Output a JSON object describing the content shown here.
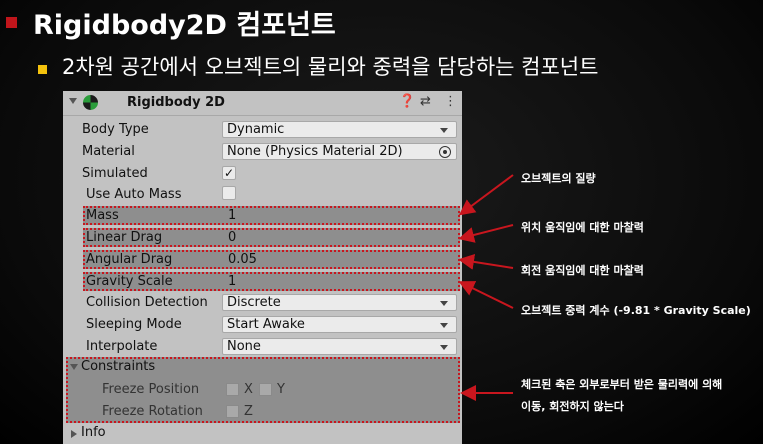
{
  "slide": {
    "title": "Rigidbody2D 컴포넌트",
    "subtitle": "2차원 공간에서 오브젝트의 물리와 중력을 담당하는 컴포넌트"
  },
  "inspector": {
    "component_title": "Rigidbody 2D",
    "header_icons": [
      "help-icon",
      "preset-icon",
      "more-icon"
    ],
    "help_glyph": "❓",
    "preset_glyph": "⇄",
    "more_glyph": "⋮",
    "rows": {
      "body_type": {
        "label": "Body Type",
        "value": "Dynamic"
      },
      "material": {
        "label": "Material",
        "value": "None (Physics Material 2D)"
      },
      "simulated": {
        "label": "Simulated",
        "checked": "✓"
      },
      "use_auto_mass": {
        "label": "Use Auto Mass"
      },
      "mass": {
        "label": "Mass",
        "value": "1"
      },
      "linear_drag": {
        "label": "Linear Drag",
        "value": "0"
      },
      "angular_drag": {
        "label": "Angular Drag",
        "value": "0.05"
      },
      "gravity_scale": {
        "label": "Gravity Scale",
        "value": "1"
      },
      "collision_detection": {
        "label": "Collision Detection",
        "value": "Discrete"
      },
      "sleeping_mode": {
        "label": "Sleeping Mode",
        "value": "Start Awake"
      },
      "interpolate": {
        "label": "Interpolate",
        "value": "None"
      }
    },
    "constraints": {
      "label": "Constraints",
      "freeze_position": {
        "label": "Freeze Position",
        "x": "X",
        "y": "Y"
      },
      "freeze_rotation": {
        "label": "Freeze Rotation",
        "z": "Z"
      }
    },
    "info": {
      "label": "Info"
    }
  },
  "annotations": {
    "mass": "오브젝트의 질량",
    "linear_drag": "위치 움직임에 대한 마찰력",
    "angular_drag": "회전 움직임에 대한 마찰력",
    "gravity_scale": "오브젝트 중력 계수 (-9.81 * Gravity Scale)",
    "constraints_line1": "체크된 축은 외부로부터 받은 물리력에 의해",
    "constraints_line2": "이동, 회전하지 않는다"
  },
  "colors": {
    "title_bullet": "#c0151b",
    "sub_bullet": "#f4c20d",
    "highlight_border": "#c8161e",
    "arrow": "#c8161e"
  }
}
